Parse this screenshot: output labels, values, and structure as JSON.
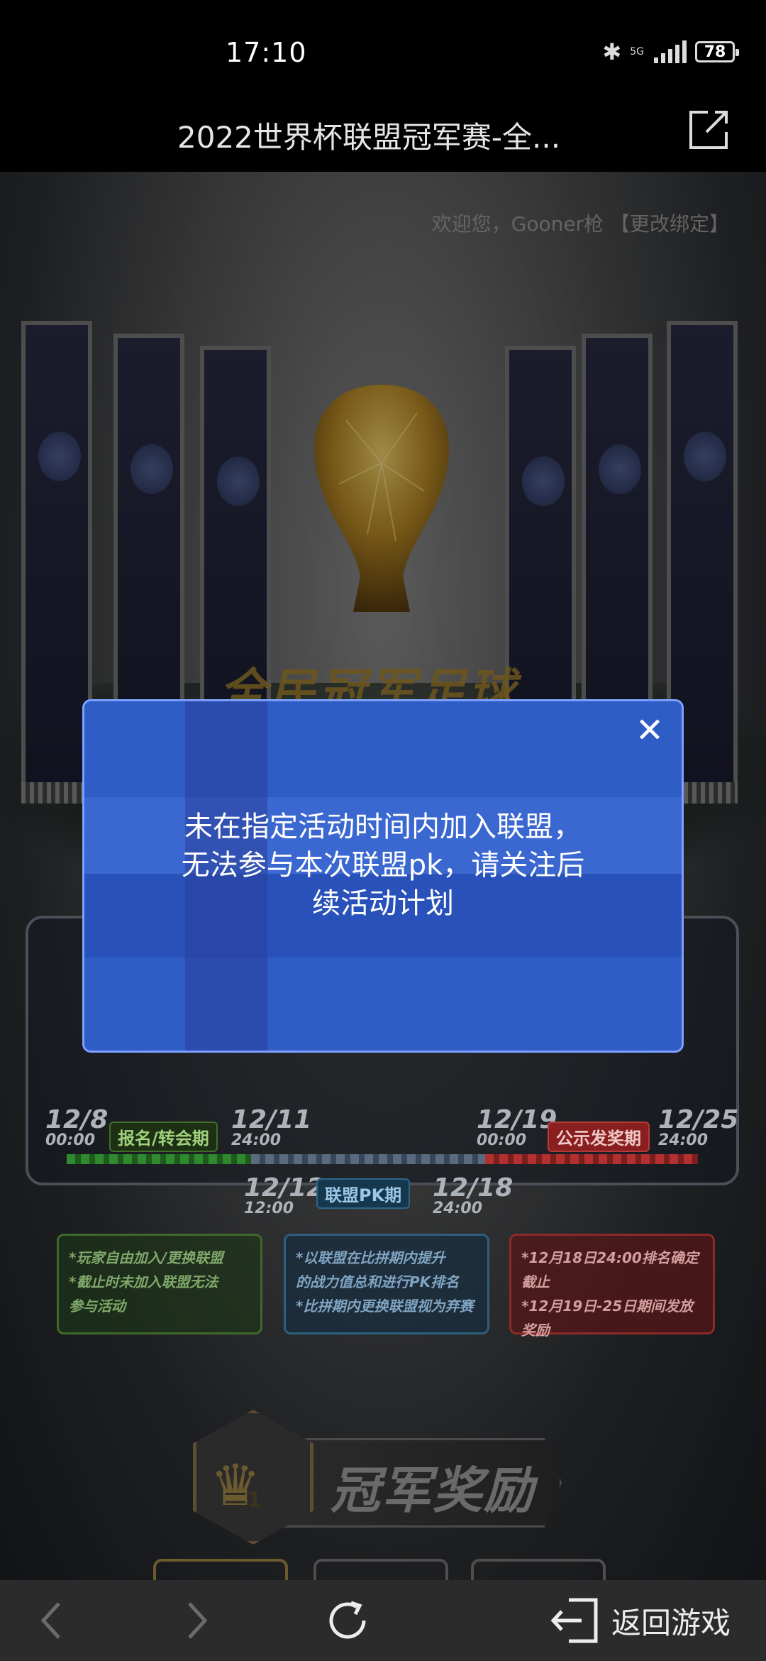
{
  "status_bar": {
    "time": "17:10",
    "network": "5G",
    "battery": "78"
  },
  "header": {
    "title": "2022世界杯联盟冠军赛-全..."
  },
  "page": {
    "welcome_prefix": "欢迎您，Gooner枪",
    "rebind_link": "【更改绑定】",
    "game_logo": "全民冠军足球"
  },
  "timeline": {
    "dates": [
      {
        "date": "12/8",
        "time": "00:00"
      },
      {
        "date": "12/11",
        "time": "24:00"
      },
      {
        "date": "12/19",
        "time": "00:00"
      },
      {
        "date": "12/25",
        "time": "24:00"
      },
      {
        "date": "12/12",
        "time": "12:00"
      },
      {
        "date": "12/18",
        "time": "24:00"
      }
    ],
    "phases": {
      "signup": "报名/转会期",
      "announce": "公示发奖期",
      "pk": "联盟PK期"
    },
    "info": {
      "green": [
        "*玩家自由加入/更换联盟",
        "*截止时未加入联盟无法",
        "参与活动"
      ],
      "blue": [
        "*以联盟在比拼期内提升",
        "的战力值总和进行PK排名",
        "*比拼期内更换联盟视为弃赛"
      ],
      "red": [
        "*12月18日24:00排名确定截止",
        "*12月19日-25日期间发放奖励"
      ]
    }
  },
  "reward": {
    "rank": "1",
    "label": "冠军奖励"
  },
  "modal": {
    "close_label": "✕",
    "message_lines": [
      "未在指定活动时间内加入联盟，",
      "无法参与本次联盟pk，请关注后",
      "续活动计划"
    ]
  },
  "bottom_nav": {
    "back_to_game": "返回游戏"
  },
  "colors": {
    "modal_bg": "#2f5dc6",
    "modal_border": "#7da0ff",
    "nav_bg": "#2b2b2b"
  }
}
